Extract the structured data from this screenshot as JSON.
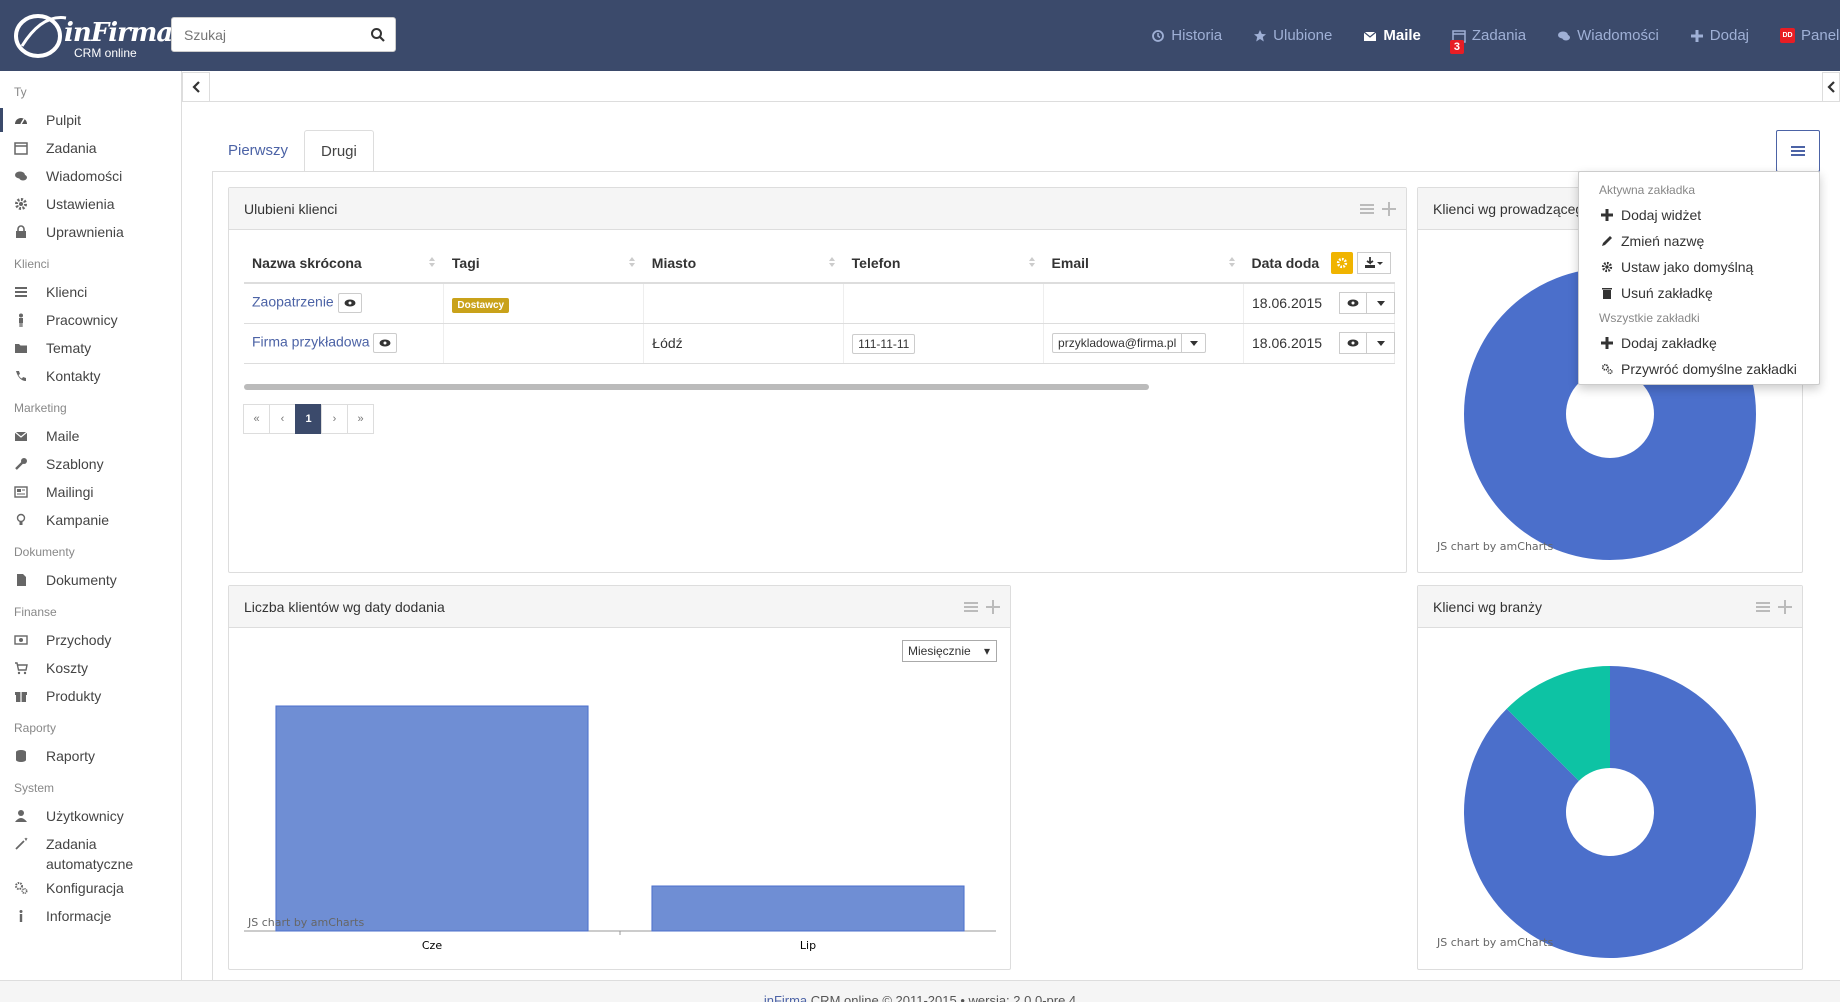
{
  "brand": {
    "name": "inFirma",
    "sub": "CRM online"
  },
  "search": {
    "placeholder": "Szukaj"
  },
  "topnav": {
    "historia": "Historia",
    "ulubione": "Ulubione",
    "maile": "Maile",
    "zadania": "Zadania",
    "zadania_badge": "3",
    "wiadomosci": "Wiadomości",
    "dodaj": "Dodaj",
    "panel": "Panel",
    "panel_initials": "DD"
  },
  "sidebar": {
    "ty": "Ty",
    "pulpit": "Pulpit",
    "zadania": "Zadania",
    "wiadomosci": "Wiadomości",
    "ustawienia": "Ustawienia",
    "uprawnienia": "Uprawnienia",
    "klienci_sec": "Klienci",
    "klienci": "Klienci",
    "pracownicy": "Pracownicy",
    "tematy": "Tematy",
    "kontakty": "Kontakty",
    "marketing": "Marketing",
    "maile": "Maile",
    "szablony": "Szablony",
    "mailingi": "Mailingi",
    "kampanie": "Kampanie",
    "dokumenty_sec": "Dokumenty",
    "dokumenty": "Dokumenty",
    "finanse": "Finanse",
    "przychody": "Przychody",
    "koszty": "Koszty",
    "produkty": "Produkty",
    "raporty_sec": "Raporty",
    "raporty": "Raporty",
    "system": "System",
    "uzytkownicy": "Użytkownicy",
    "zadania_auto": "Zadania automatyczne",
    "konfiguracja": "Konfiguracja",
    "informacje": "Informacje"
  },
  "tabs": {
    "first": "Pierwszy",
    "second": "Drugi"
  },
  "widget_fav": {
    "title": "Ulubieni klienci",
    "columns": [
      "Nazwa skrócona",
      "Tagi",
      "Miasto",
      "Telefon",
      "Email",
      "Data doda"
    ],
    "rows": [
      {
        "name": "Zaopatrzenie",
        "tag": "Dostawcy",
        "city": "",
        "phone": "",
        "email": "",
        "date": "18.06.2015"
      },
      {
        "name": "Firma przykładowa",
        "tag": "",
        "city": "Łódź",
        "phone": "111-11-11",
        "email": "przykladowa@firma.pl",
        "date": "18.06.2015"
      }
    ],
    "pager": {
      "first": "«",
      "prev": "‹",
      "page": "1",
      "next": "›",
      "last": "»"
    }
  },
  "widget_prow": {
    "title": "Klienci wg prowadzącego",
    "credit": "JS chart by amCharts"
  },
  "widget_date": {
    "title": "Liczba klientów wg daty dodania",
    "select": "Miesięcznie",
    "credit": "JS chart by amCharts"
  },
  "widget_branza": {
    "title": "Klienci wg branży",
    "credit": "JS chart by amCharts"
  },
  "menu": {
    "active_head": "Aktywna zakładka",
    "add_widget": "Dodaj widżet",
    "rename": "Zmień nazwę",
    "set_default": "Ustaw jako domyślną",
    "delete_tab": "Usuń zakładkę",
    "all_head": "Wszystkie zakładki",
    "add_tab": "Dodaj zakładkę",
    "restore": "Przywróć domyślne zakładki"
  },
  "chart_data": [
    {
      "type": "bar",
      "categories": [
        "Cze",
        "Lip"
      ],
      "values": [
        10,
        2
      ],
      "ylim": [
        0,
        10
      ],
      "title": "Liczba klientów wg daty dodania",
      "color": "#6f8ed4"
    },
    {
      "type": "pie",
      "title": "Klienci wg prowadzącego",
      "values": [
        1
      ],
      "colors": [
        "#4b6fcb"
      ]
    },
    {
      "type": "pie",
      "title": "Klienci wg branży",
      "values": [
        87.5,
        12.5
      ],
      "colors": [
        "#4b6fcb",
        "#0dc3a4"
      ]
    }
  ],
  "footer": {
    "brand": "inFirma",
    "text": "CRM online © 2011-2015 • wersja: 2.0.0-pre.4"
  }
}
